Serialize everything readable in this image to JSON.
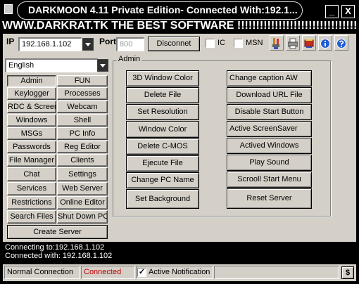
{
  "window": {
    "title": "DARKMOON 4.11 Private Edition- Connected With:192.1...",
    "minimize_glyph": "_",
    "close_glyph": "X"
  },
  "banner": "WWW.DARKRAT.TK THE BEST SOFTWARE !!!!!!!!!!!!!!!!!!!!!!!!!!!!!!!!",
  "connection": {
    "ip_label": "IP",
    "ip_value": "192.168.1.102",
    "port_label": "Port",
    "port_value": "800",
    "disconnect_label": "Disconnet",
    "ic_label": "IC",
    "msn_label": "MSN"
  },
  "toolbar_icons": [
    "brush-icon",
    "printer-icon",
    "book-icon",
    "info-icon",
    "help-icon"
  ],
  "language": "English",
  "nav": [
    [
      "Admin",
      "FUN"
    ],
    [
      "Keylogger",
      "Processes"
    ],
    [
      "RDC & Screen",
      "Webcam"
    ],
    [
      "Windows",
      "Shell"
    ],
    [
      "MSGs",
      "PC Info"
    ],
    [
      "Passwords",
      "Reg Editor"
    ],
    [
      "File Manager",
      "Clients"
    ],
    [
      "Chat",
      "Settings"
    ],
    [
      "Services",
      "Web Server"
    ],
    [
      "Restrictions",
      "Online Editor"
    ],
    [
      "Search Files",
      "Shut Down PC"
    ]
  ],
  "create_server": "Create Server",
  "panel_title": "Admin",
  "admin_left": [
    "3D Window Color",
    "Delete File",
    "Set Resolution",
    "Window Color",
    "Delete C-MOS",
    "Ejecute File",
    "Change PC Name",
    "Set Background"
  ],
  "admin_right": [
    "Change caption  AW",
    "Download URL File",
    "Disable Start Button",
    "Active ScreenSaver",
    "Actived Windows",
    "Play Sound",
    "Scrooll Start Menu",
    "Reset Server"
  ],
  "console": [
    "Connecting to:192.168.1.102",
    "Connected with: 192.168.1.102"
  ],
  "statusbar": {
    "mode": "Normal Connection",
    "state": "Connected",
    "state_color": "#c00000",
    "notification_label": "Active Notification",
    "notification_checked": true,
    "dollar_label": "$"
  }
}
